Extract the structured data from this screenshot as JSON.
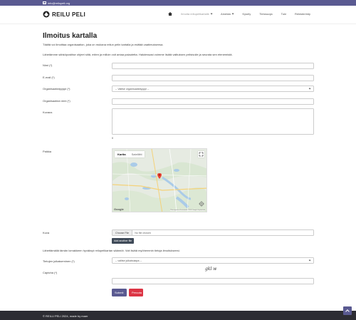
{
  "topbar": {
    "email": "info@reilupeli.org"
  },
  "brand": {
    "name": "REILU PELI"
  },
  "nav": {
    "items": [
      {
        "label": "Ilmoita reilupelikartalle",
        "active": true,
        "dropdown": true
      },
      {
        "label": "Aineisto",
        "active": false,
        "dropdown": true
      },
      {
        "label": "Kysely",
        "active": false,
        "dropdown": false
      },
      {
        "label": "Tietosuoja",
        "active": false,
        "dropdown": false
      },
      {
        "label": "Tuki",
        "active": false,
        "dropdown": false
      },
      {
        "label": "Rekisteröidy",
        "active": false,
        "dropdown": false
      }
    ]
  },
  "page": {
    "title": "Ilmoitus kartalla",
    "intro1": "Täältä voi ilmoittaa organisaation, joka on mukana reilun pelin kartalla ja esittää vaatimuksensa.",
    "intro2": "Lähetämme sähköpostitse ohjeet siitä, miten ja milloin voit antaa palautetta. Halutessasi voimme lisätä valituksen pelisivulle ja seurata sen etenemistä."
  },
  "form": {
    "name_label": "Nimi (*)",
    "email_label": "E-mail (*)",
    "org_type_label": "Organisaatiotyyppi (*)",
    "org_type_value": "-- Valitse organisaatiotyyppi --",
    "org_name_label": "Organisaation nimi (*)",
    "description_label": "Kuvaus",
    "counter": "0",
    "location_label": "Paikka",
    "image_label": "Kuva",
    "file_button": "Choose File",
    "file_text": "No file chosen",
    "add_image_button": "Add another file",
    "notice": "Lähettämällä tämän lomakkeen hyväksyt reilupelikartan säännöt. Voit lisätä myöhemmin tietoja ilmoitukseesi.",
    "publish_label": "Tietojen julkaiseminen (*)",
    "publish_value": "-- valitse julkaisutapa --",
    "captcha_label": "Captcha (*)",
    "captcha_image": "gkl w",
    "submit_label": "Submit",
    "cancel_label": "Peruuta"
  },
  "map": {
    "tab_map": "Kartta",
    "tab_satellite": "Satelliitti",
    "logo": "Google",
    "footer": "Pikanäppäimet  Karttatiedot ©2024 Google  Käyttöehdot"
  },
  "footer": {
    "text": "© REILU PELI 2024, made by maer"
  },
  "colors": {
    "brand": "#5a5a91",
    "cancel": "#dc3545",
    "footer": "#2d2d33"
  }
}
